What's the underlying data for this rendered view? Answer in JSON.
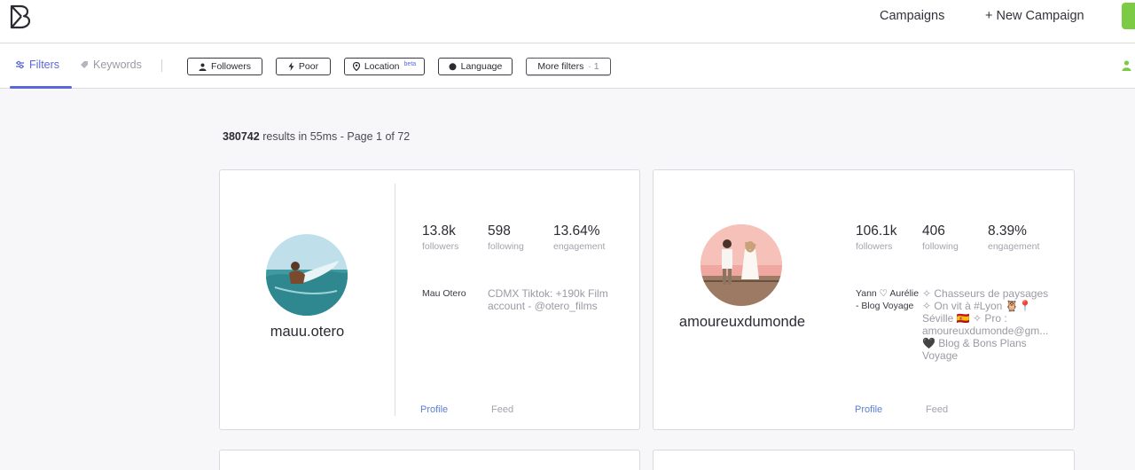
{
  "header": {
    "logo": "B",
    "nav": {
      "campaigns": "Campaigns",
      "new_campaign": "+ New Campaign"
    }
  },
  "filterbar": {
    "tabs": {
      "filters": "Filters",
      "keywords": "Keywords"
    },
    "pills": {
      "followers": "Followers",
      "poor": "Poor",
      "location": "Location",
      "location_badge": "beta",
      "language": "Language",
      "more_filters": "More filters",
      "more_filters_count": "· 1"
    }
  },
  "results": {
    "count": "380742",
    "summary": "results in 55ms - Page 1 of 72"
  },
  "cards": [
    {
      "username": "mauu.otero",
      "followers": "13.8k",
      "followers_label": "followers",
      "following": "598",
      "following_label": "following",
      "engagement": "13.64%",
      "engagement_label": "engagement",
      "fullname": "Mau Otero",
      "bio": "CDMX Tiktok: +190k Film account - @otero_films",
      "profile": "Profile",
      "feed": "Feed"
    },
    {
      "username": "amoureuxdumonde",
      "followers": "106.1k",
      "followers_label": "followers",
      "following": "406",
      "following_label": "following",
      "engagement": "8.39%",
      "engagement_label": "engagement",
      "fullname": "Yann ♡ Aurélie - Blog Voyage",
      "bio": "✧ Chasseurs de paysages ✧ On vit à #Lyon 🦉📍 Séville 🇪🇸 ✧ Pro : amoureuxdumonde@gm... 🖤 Blog & Bons Plans Voyage",
      "profile": "Profile",
      "feed": "Feed"
    }
  ],
  "colors": {
    "accent": "#5a67d8",
    "brand_green": "#7ccb45",
    "link": "#5a7fd8"
  }
}
